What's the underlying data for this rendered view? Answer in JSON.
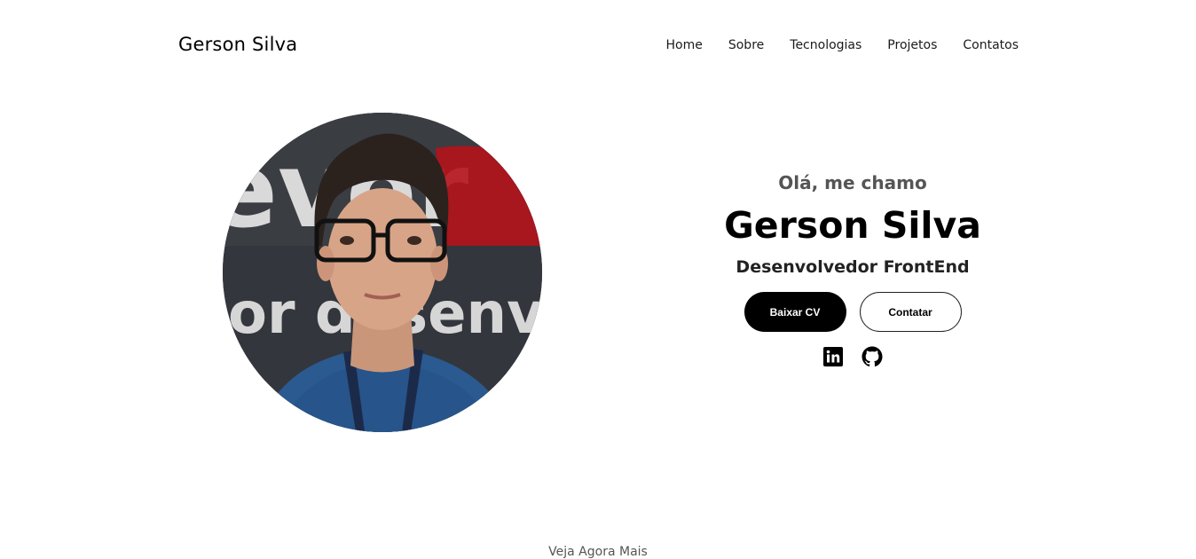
{
  "header": {
    "brand": "Gerson Silva",
    "nav": [
      "Home",
      "Sobre",
      "Tecnologias",
      "Projetos",
      "Contatos"
    ]
  },
  "hero": {
    "greeting": "Olá, me chamo",
    "name": "Gerson Silva",
    "role": "Desenvolvedor FrontEnd",
    "primary_button": "Baixar CV",
    "secondary_button": "Contatar",
    "socials": [
      "linkedin-icon",
      "github-icon"
    ]
  },
  "photo_background_text": {
    "top": "ever",
    "bottom": "or desenvolv"
  },
  "footer_hint": "Veja Agora Mais",
  "colors": {
    "accent": "#000000",
    "background": "#ffffff"
  }
}
